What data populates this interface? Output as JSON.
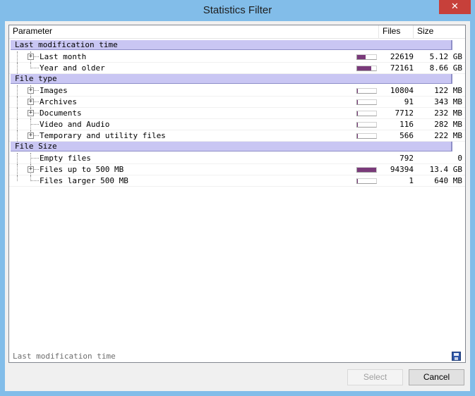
{
  "window": {
    "title": "Statistics Filter",
    "close_glyph": "✕"
  },
  "columns": {
    "parameter": "Parameter",
    "files": "Files",
    "size": "Size"
  },
  "groups": {
    "g1": {
      "label": "Last modification time",
      "items": [
        {
          "label": "Last month",
          "files": "22619",
          "size": "5.12 GB",
          "bar": 0.45
        },
        {
          "label": "Year and older",
          "files": "72161",
          "size": "8.66 GB",
          "bar": 0.75
        }
      ]
    },
    "g2": {
      "label": "File type",
      "items": [
        {
          "label": "Images",
          "files": "10804",
          "size": "122 MB",
          "bar": 0.02
        },
        {
          "label": "Archives",
          "files": "91",
          "size": "343 MB",
          "bar": 0.02
        },
        {
          "label": "Documents",
          "files": "7712",
          "size": "232 MB",
          "bar": 0.02
        },
        {
          "label": "Video and Audio",
          "files": "116",
          "size": "282 MB",
          "bar": 0.02
        },
        {
          "label": "Temporary and utility files",
          "files": "566",
          "size": "222 MB",
          "bar": 0.02
        }
      ]
    },
    "g3": {
      "label": "File Size",
      "items": [
        {
          "label": "Empty files",
          "files": "792",
          "size": "0"
        },
        {
          "label": "Files up to 500 MB",
          "files": "94394",
          "size": "13.4 GB",
          "bar": 1.0
        },
        {
          "label": "Files larger 500 MB",
          "files": "1",
          "size": "640 MB",
          "bar": 0.02
        }
      ]
    }
  },
  "status": {
    "text": "Last modification time",
    "save_icon": "save-icon"
  },
  "buttons": {
    "select": "Select",
    "cancel": "Cancel"
  },
  "colors": {
    "bar_fill": "#7a3a7a",
    "group_bg": "#c9c6f3",
    "close_bg": "#c7403a"
  }
}
